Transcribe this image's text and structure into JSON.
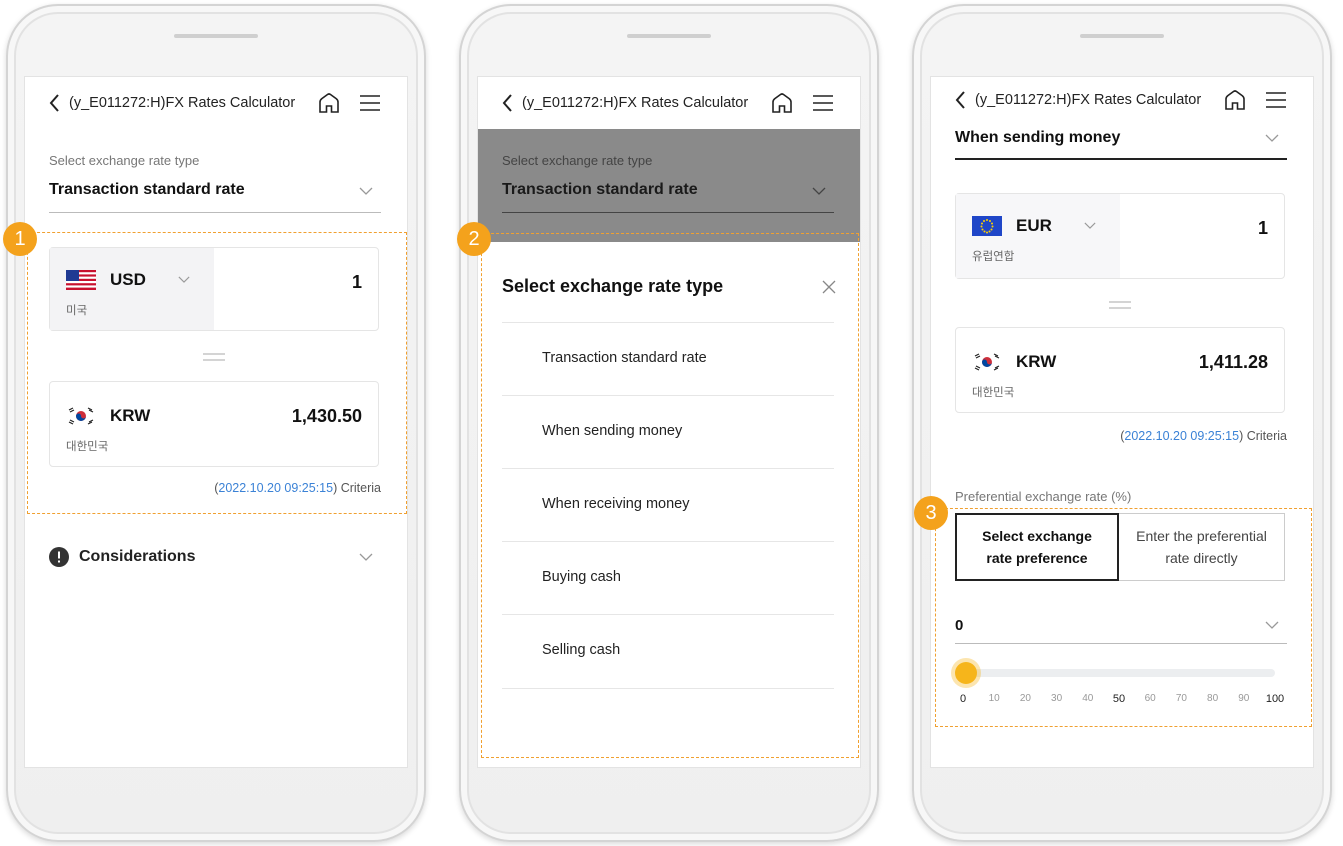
{
  "header": {
    "title": "(y_E011272:H)FX Rates Calculator"
  },
  "screen1": {
    "select_label": "Select exchange rate type",
    "select_value": "Transaction standard rate",
    "from": {
      "code": "USD",
      "country": "미국",
      "amount": "1"
    },
    "to": {
      "code": "KRW",
      "country": "대한민국",
      "amount": "1,430.50"
    },
    "timestamp": "2022.10.20 09:25:15",
    "criteria_open": "(",
    "criteria_close": ") Criteria",
    "considerations": "Considerations",
    "badge": "1"
  },
  "screen2": {
    "select_label": "Select exchange rate type",
    "select_value": "Transaction standard rate",
    "sheet_title": "Select exchange rate type",
    "options": [
      "Transaction standard rate",
      "When sending money",
      "When receiving money",
      "Buying cash",
      "Selling cash"
    ],
    "badge": "2"
  },
  "screen3": {
    "select_value": "When sending money",
    "from": {
      "code": "EUR",
      "country": "유럽연합",
      "amount": "1"
    },
    "to": {
      "code": "KRW",
      "country": "대한민국",
      "amount": "1,411.28"
    },
    "timestamp": "2022.10.20 09:25:15",
    "criteria_open": "(",
    "criteria_close": ") Criteria",
    "pref_label": "Preferential exchange rate (%)",
    "seg_active_line1": "Select exchange",
    "seg_active_line2": "rate preference",
    "seg_inactive_line1": "Enter the preferential",
    "seg_inactive_line2": "rate directly",
    "pref_value": "0",
    "slider_value": 0,
    "ticks": [
      "0",
      "10",
      "20",
      "30",
      "40",
      "50",
      "60",
      "70",
      "80",
      "90",
      "100"
    ],
    "badge": "3"
  },
  "colors": {
    "accent": "#f4a21c",
    "timestamp": "#3b82d6",
    "overlay": "#8a8a8a"
  }
}
